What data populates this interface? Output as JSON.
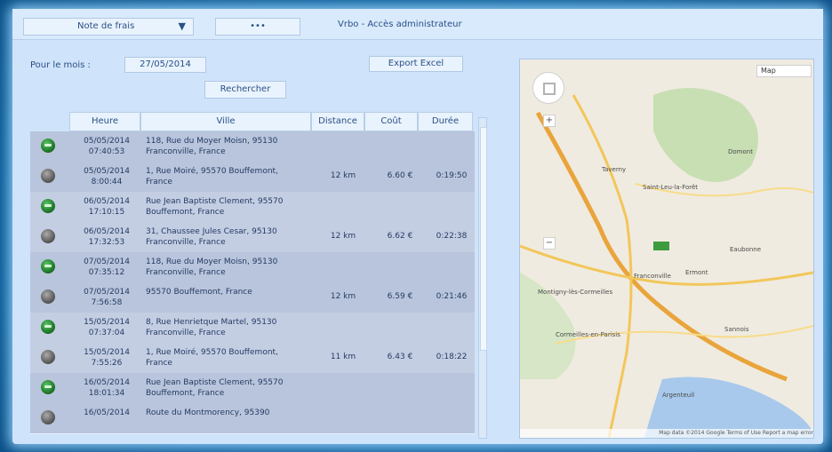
{
  "app": {
    "selector_label": "Note de frais",
    "dots_label": "•••",
    "title": "Vrbo - Accès administrateur"
  },
  "filters": {
    "month_label": "Pour le mois :",
    "date_value": "27/05/2014",
    "export_label": "Export Excel",
    "search_label": "Rechercher"
  },
  "table": {
    "headers": [
      "Heure",
      "Ville",
      "Distance",
      "Coût",
      "Durée"
    ],
    "rows": [
      {
        "status": "start",
        "date": "05/05/2014",
        "time": "07:40:53",
        "address": "118, Rue du Moyer Moisn, 95130",
        "city": "Franconville, France",
        "distance": "",
        "cost": "",
        "duration": ""
      },
      {
        "status": "stop",
        "date": "05/05/2014",
        "time": "8:00:44",
        "address": "1, Rue Moiré, 95570 Bouffemont,",
        "city": "France",
        "distance": "12 km",
        "cost": "6.60 €",
        "duration": "0:19:50"
      },
      {
        "status": "start",
        "date": "06/05/2014",
        "time": "17:10:15",
        "address": "Rue Jean Baptiste Clement, 95570",
        "city": "Bouffemont, France",
        "distance": "",
        "cost": "",
        "duration": ""
      },
      {
        "status": "stop",
        "date": "06/05/2014",
        "time": "17:32:53",
        "address": "31, Chaussee Jules Cesar, 95130",
        "city": "Franconville, France",
        "distance": "12 km",
        "cost": "6.62 €",
        "duration": "0:22:38"
      },
      {
        "status": "start",
        "date": "07/05/2014",
        "time": "07:35:12",
        "address": "118, Rue du Moyer Moisn, 95130",
        "city": "Franconville, France",
        "distance": "",
        "cost": "",
        "duration": ""
      },
      {
        "status": "stop",
        "date": "07/05/2014",
        "time": "7:56:58",
        "address": "95570 Bouffemont, France",
        "city": "",
        "distance": "12 km",
        "cost": "6.59 €",
        "duration": "0:21:46"
      },
      {
        "status": "start",
        "date": "15/05/2014",
        "time": "07:37:04",
        "address": "8, Rue Henrietque Martel, 95130",
        "city": "Franconville, France",
        "distance": "",
        "cost": "",
        "duration": ""
      },
      {
        "status": "stop",
        "date": "15/05/2014",
        "time": "7:55:26",
        "address": "1, Rue Moiré, 95570 Bouffemont,",
        "city": "France",
        "distance": "11 km",
        "cost": "6.43 €",
        "duration": "0:18:22"
      },
      {
        "status": "start",
        "date": "16/05/2014",
        "time": "18:01:34",
        "address": "Rue Jean Baptiste Clement, 95570",
        "city": "Bouffemont, France",
        "distance": "",
        "cost": "",
        "duration": ""
      },
      {
        "status": "stop",
        "date": "16/05/2014",
        "time": "",
        "address": "Route du Montmorency, 95390",
        "city": "",
        "distance": "",
        "cost": "",
        "duration": ""
      }
    ]
  },
  "map": {
    "type_selector": "Map",
    "zoom_in": "+",
    "zoom_out": "−",
    "footer": "Map data ©2014 Google   Terms of Use   Report a map error",
    "labels": [
      "Taverny",
      "Saint-Leu-la-Forêt",
      "Franconville",
      "Ermont",
      "Argenteuil",
      "Sannois",
      "Eaubonne",
      "Montigny-lès-Cormeilles",
      "Cormeilles-en-Parisis",
      "Domont"
    ]
  }
}
